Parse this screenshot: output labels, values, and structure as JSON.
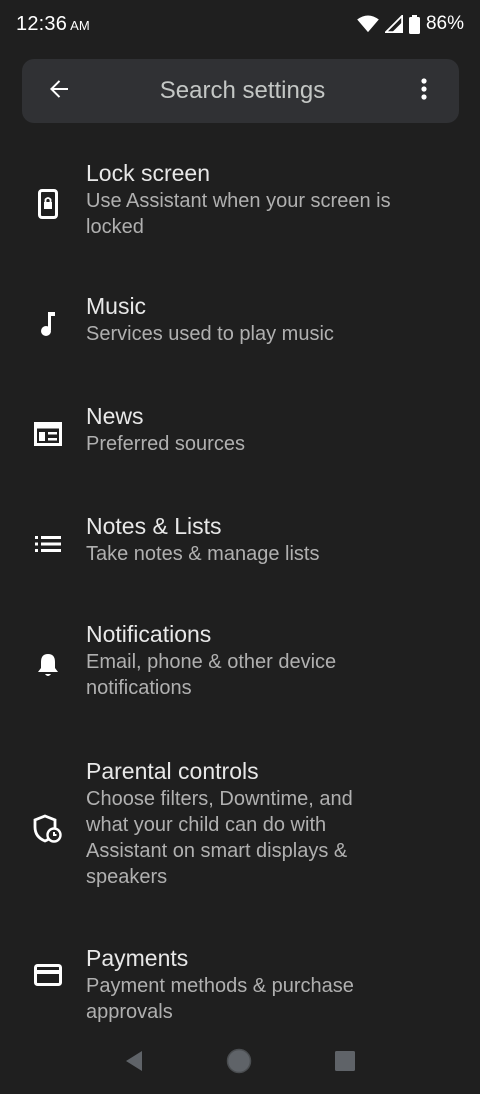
{
  "status": {
    "time": "12:36",
    "ampm": "AM",
    "battery": "86%"
  },
  "search": {
    "placeholder": "Search settings"
  },
  "items": [
    {
      "title": "Lock screen",
      "subtitle": "Use Assistant when your screen is locked",
      "icon": "lock-screen-phone-icon"
    },
    {
      "title": "Music",
      "subtitle": "Services used to play music",
      "icon": "music-note-icon"
    },
    {
      "title": "News",
      "subtitle": "Preferred sources",
      "icon": "newspaper-icon"
    },
    {
      "title": "Notes & Lists",
      "subtitle": "Take notes & manage lists",
      "icon": "list-icon"
    },
    {
      "title": "Notifications",
      "subtitle": "Email, phone & other device notifications",
      "icon": "bell-icon"
    },
    {
      "title": "Parental controls",
      "subtitle": "Choose filters, Downtime, and what your child can do with Assistant on smart displays & speakers",
      "icon": "shield-clock-icon"
    },
    {
      "title": "Payments",
      "subtitle": "Payment methods & purchase approvals",
      "icon": "credit-card-icon"
    }
  ],
  "colors": {
    "background": "#1f1f1f",
    "search_bg": "#303134",
    "title": "#e8e8e8",
    "subtitle": "#b0b0b0"
  }
}
